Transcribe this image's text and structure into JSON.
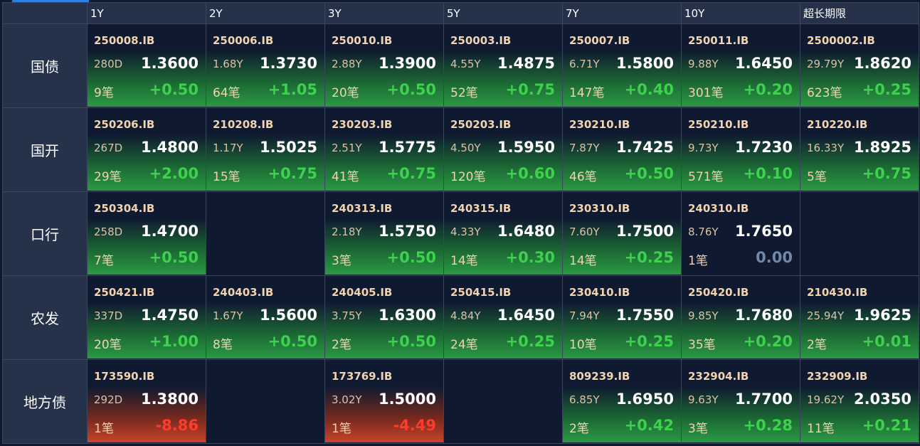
{
  "tenors": [
    "1Y",
    "2Y",
    "3Y",
    "5Y",
    "7Y",
    "10Y",
    "超长期限"
  ],
  "rows": [
    {
      "label": "国债",
      "cells": [
        {
          "code": "250008.IB",
          "tenor": "280D",
          "yield": "1.3600",
          "count": "9笔",
          "change": "+0.50",
          "trend": "up"
        },
        {
          "code": "250006.IB",
          "tenor": "1.68Y",
          "yield": "1.3730",
          "count": "64笔",
          "change": "+1.05",
          "trend": "up"
        },
        {
          "code": "250010.IB",
          "tenor": "2.88Y",
          "yield": "1.3900",
          "count": "20笔",
          "change": "+0.50",
          "trend": "up"
        },
        {
          "code": "250003.IB",
          "tenor": "4.55Y",
          "yield": "1.4875",
          "count": "52笔",
          "change": "+0.75",
          "trend": "up"
        },
        {
          "code": "250007.IB",
          "tenor": "6.71Y",
          "yield": "1.5800",
          "count": "147笔",
          "change": "+0.40",
          "trend": "up"
        },
        {
          "code": "250011.IB",
          "tenor": "9.88Y",
          "yield": "1.6450",
          "count": "301笔",
          "change": "+0.20",
          "trend": "up"
        },
        {
          "code": "2500002.IB",
          "tenor": "29.79Y",
          "yield": "1.8620",
          "count": "623笔",
          "change": "+0.25",
          "trend": "up"
        }
      ]
    },
    {
      "label": "国开",
      "cells": [
        {
          "code": "250206.IB",
          "tenor": "267D",
          "yield": "1.4800",
          "count": "29笔",
          "change": "+2.00",
          "trend": "up"
        },
        {
          "code": "210208.IB",
          "tenor": "1.17Y",
          "yield": "1.5025",
          "count": "15笔",
          "change": "+0.75",
          "trend": "up"
        },
        {
          "code": "230203.IB",
          "tenor": "2.51Y",
          "yield": "1.5775",
          "count": "41笔",
          "change": "+0.75",
          "trend": "up"
        },
        {
          "code": "250203.IB",
          "tenor": "4.50Y",
          "yield": "1.5950",
          "count": "120笔",
          "change": "+0.60",
          "trend": "up"
        },
        {
          "code": "230210.IB",
          "tenor": "7.87Y",
          "yield": "1.7425",
          "count": "46笔",
          "change": "+0.50",
          "trend": "up"
        },
        {
          "code": "250210.IB",
          "tenor": "9.73Y",
          "yield": "1.7230",
          "count": "571笔",
          "change": "+0.10",
          "trend": "up"
        },
        {
          "code": "210220.IB",
          "tenor": "16.33Y",
          "yield": "1.8925",
          "count": "5笔",
          "change": "+0.75",
          "trend": "up"
        }
      ]
    },
    {
      "label": "口行",
      "cells": [
        {
          "code": "250304.IB",
          "tenor": "258D",
          "yield": "1.4700",
          "count": "7笔",
          "change": "+0.50",
          "trend": "up"
        },
        null,
        {
          "code": "240313.IB",
          "tenor": "2.18Y",
          "yield": "1.5750",
          "count": "3笔",
          "change": "+0.50",
          "trend": "up"
        },
        {
          "code": "240315.IB",
          "tenor": "4.33Y",
          "yield": "1.6480",
          "count": "14笔",
          "change": "+0.30",
          "trend": "up"
        },
        {
          "code": "230310.IB",
          "tenor": "7.60Y",
          "yield": "1.7500",
          "count": "14笔",
          "change": "+0.25",
          "trend": "up"
        },
        {
          "code": "240310.IB",
          "tenor": "8.76Y",
          "yield": "1.7650",
          "count": "1笔",
          "change": "0.00",
          "trend": "flat"
        },
        null
      ]
    },
    {
      "label": "农发",
      "cells": [
        {
          "code": "250421.IB",
          "tenor": "337D",
          "yield": "1.4750",
          "count": "20笔",
          "change": "+1.00",
          "trend": "up"
        },
        {
          "code": "240403.IB",
          "tenor": "1.67Y",
          "yield": "1.5600",
          "count": "8笔",
          "change": "+0.50",
          "trend": "up"
        },
        {
          "code": "240405.IB",
          "tenor": "3.75Y",
          "yield": "1.6300",
          "count": "2笔",
          "change": "+0.50",
          "trend": "up"
        },
        {
          "code": "250415.IB",
          "tenor": "4.84Y",
          "yield": "1.6450",
          "count": "24笔",
          "change": "+0.25",
          "trend": "up"
        },
        {
          "code": "230410.IB",
          "tenor": "7.94Y",
          "yield": "1.7550",
          "count": "10笔",
          "change": "+0.25",
          "trend": "up"
        },
        {
          "code": "250420.IB",
          "tenor": "9.85Y",
          "yield": "1.7680",
          "count": "35笔",
          "change": "+0.20",
          "trend": "up"
        },
        {
          "code": "210430.IB",
          "tenor": "25.94Y",
          "yield": "1.9625",
          "count": "2笔",
          "change": "+0.01",
          "trend": "up"
        }
      ]
    },
    {
      "label": "地方债",
      "cells": [
        {
          "code": "173590.IB",
          "tenor": "292D",
          "yield": "1.3800",
          "count": "1笔",
          "change": "-8.86",
          "trend": "down"
        },
        null,
        {
          "code": "173769.IB",
          "tenor": "3.02Y",
          "yield": "1.5000",
          "count": "1笔",
          "change": "-4.49",
          "trend": "down"
        },
        null,
        {
          "code": "809239.IB",
          "tenor": "6.85Y",
          "yield": "1.6950",
          "count": "2笔",
          "change": "+0.42",
          "trend": "up"
        },
        {
          "code": "232904.IB",
          "tenor": "9.63Y",
          "yield": "1.7700",
          "count": "3笔",
          "change": "+0.28",
          "trend": "up"
        },
        {
          "code": "232909.IB",
          "tenor": "19.62Y",
          "yield": "2.0350",
          "count": "11笔",
          "change": "+0.21",
          "trend": "up"
        }
      ]
    }
  ]
}
